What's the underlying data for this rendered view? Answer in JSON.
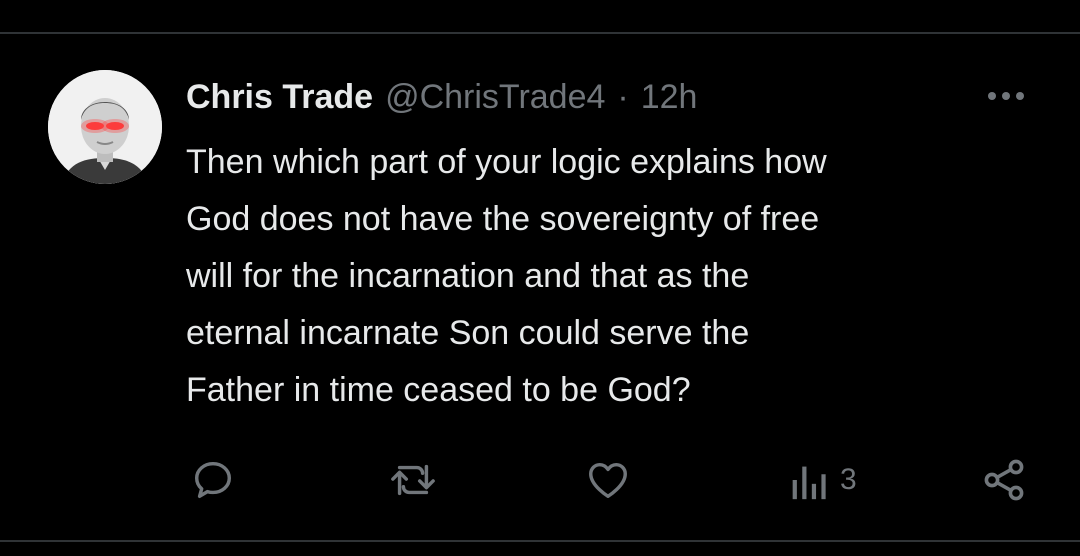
{
  "post": {
    "author_name": "Chris Trade",
    "author_handle": "@ChrisTrade4",
    "separator": "·",
    "time": "12h",
    "text": "Then which part of your logic explains how\nGod does not have the sovereignty of free\nwill for the incarnation and that as the\neternal incarnate Son could serve the\nFather in time ceased to be God?",
    "more_icon": "more-horizontal-icon"
  },
  "actions": {
    "reply": {
      "icon": "reply-icon"
    },
    "repost": {
      "icon": "repost-icon"
    },
    "like": {
      "icon": "heart-icon"
    },
    "views": {
      "icon": "views-chart-icon",
      "count": "3"
    },
    "share": {
      "icon": "share-icon"
    }
  },
  "colors": {
    "background": "#000000",
    "text_primary": "#e7e9ea",
    "text_secondary": "#71767b",
    "divider": "#2f3336"
  }
}
